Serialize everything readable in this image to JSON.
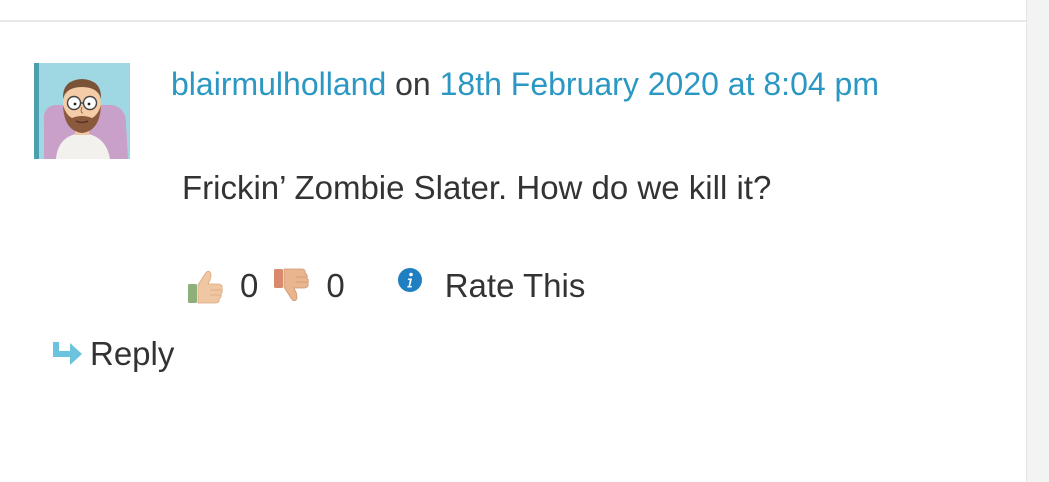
{
  "comment": {
    "author": "blairmulholland",
    "on_word": "on",
    "timestamp": "18th February 2020 at 8:04 pm",
    "text": "Frickin’ Zombie Slater. How do we kill it?"
  },
  "rating": {
    "likes": "0",
    "dislikes": "0",
    "rate_label": "Rate This"
  },
  "actions": {
    "reply_label": "Reply"
  },
  "colors": {
    "link": "#2b97c3",
    "text": "#333333",
    "reply_arrow": "#6cc3dd",
    "info_badge": "#1f7fc1"
  },
  "icons": {
    "avatar": "cartoon-bearded-man-avatar",
    "like": "thumbs-up-icon",
    "dislike": "thumbs-down-icon",
    "info": "info-icon",
    "reply": "reply-arrow-icon"
  }
}
